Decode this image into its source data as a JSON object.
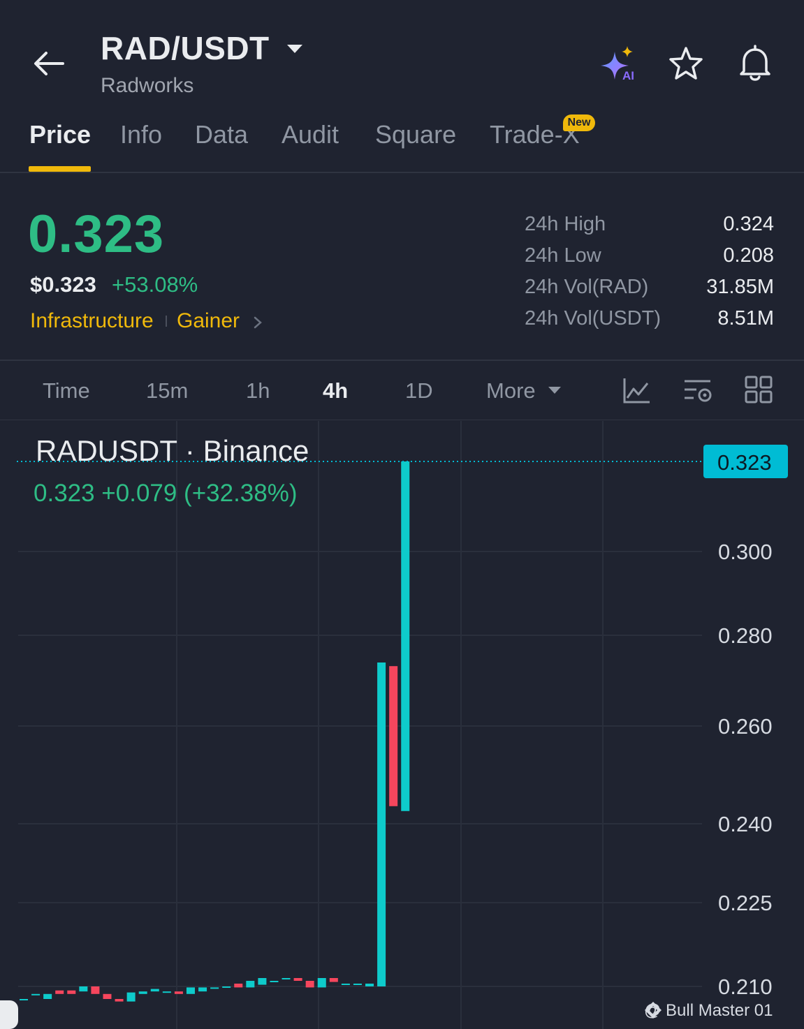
{
  "header": {
    "pair": "RAD/USDT",
    "subtitle": "Radworks",
    "icons": [
      "back-arrow-icon",
      "caret-down-icon",
      "ai-sparkle-icon",
      "star-icon",
      "bell-icon"
    ]
  },
  "tabs": {
    "items": [
      "Price",
      "Info",
      "Data",
      "Audit",
      "Square",
      "Trade-X"
    ],
    "active": "Price",
    "new_badge": "New"
  },
  "price": {
    "last": "0.323",
    "usd": "$0.323",
    "change_pct": "+53.08%",
    "tags": [
      "Infrastructure",
      "Gainer"
    ]
  },
  "stats": [
    {
      "label": "24h High",
      "value": "0.324"
    },
    {
      "label": "24h Low",
      "value": "0.208"
    },
    {
      "label": "24h Vol(RAD)",
      "value": "31.85M"
    },
    {
      "label": "24h Vol(USDT)",
      "value": "8.51M"
    }
  ],
  "intervals": {
    "items": [
      "Time",
      "15m",
      "1h",
      "4h",
      "1D",
      "More"
    ],
    "active": "4h"
  },
  "colors": {
    "background": "#1f2330",
    "up": "#2ebd85",
    "candle_up": "#0ecbcb",
    "candle_down": "#f6465d",
    "accent": "#f0b90b",
    "price_tag": "#00bcd4"
  },
  "chart_data": {
    "type": "candlestick",
    "title": "RADUSDT · Binance",
    "last_label": "0.323  +0.079 (+32.38%)",
    "last_price": 0.323,
    "y_ticks": [
      "0.300",
      "0.280",
      "0.260",
      "0.240",
      "0.225",
      "0.210"
    ],
    "y_tick_values": [
      0.3,
      0.28,
      0.26,
      0.24,
      0.225,
      0.21
    ],
    "ylim": [
      0.2075,
      0.334
    ],
    "price_tag": "0.323",
    "candles": [
      {
        "o": 0.2075,
        "c": 0.2075,
        "h": 0.2075,
        "l": 0.2075
      },
      {
        "o": 0.2085,
        "c": 0.2085,
        "h": 0.2085,
        "l": 0.2085
      },
      {
        "o": 0.2075,
        "c": 0.2085,
        "h": 0.2085,
        "l": 0.2075
      },
      {
        "o": 0.2092,
        "c": 0.2085,
        "h": 0.2092,
        "l": 0.2085
      },
      {
        "o": 0.2092,
        "c": 0.2085,
        "h": 0.2092,
        "l": 0.2085
      },
      {
        "o": 0.209,
        "c": 0.21,
        "h": 0.21,
        "l": 0.209
      },
      {
        "o": 0.21,
        "c": 0.2085,
        "h": 0.21,
        "l": 0.2085
      },
      {
        "o": 0.2085,
        "c": 0.2075,
        "h": 0.2085,
        "l": 0.2075
      },
      {
        "o": 0.2075,
        "c": 0.207,
        "h": 0.2075,
        "l": 0.207
      },
      {
        "o": 0.207,
        "c": 0.2088,
        "h": 0.2088,
        "l": 0.207
      },
      {
        "o": 0.2085,
        "c": 0.209,
        "h": 0.209,
        "l": 0.2085
      },
      {
        "o": 0.209,
        "c": 0.2095,
        "h": 0.2095,
        "l": 0.209
      },
      {
        "o": 0.209,
        "c": 0.209,
        "h": 0.209,
        "l": 0.209
      },
      {
        "o": 0.209,
        "c": 0.2085,
        "h": 0.209,
        "l": 0.2085
      },
      {
        "o": 0.2085,
        "c": 0.2098,
        "h": 0.2098,
        "l": 0.2085
      },
      {
        "o": 0.209,
        "c": 0.2098,
        "h": 0.2098,
        "l": 0.209
      },
      {
        "o": 0.2098,
        "c": 0.2098,
        "h": 0.2098,
        "l": 0.2098
      },
      {
        "o": 0.21,
        "c": 0.21,
        "h": 0.21,
        "l": 0.21
      },
      {
        "o": 0.2105,
        "c": 0.2098,
        "h": 0.2105,
        "l": 0.2098
      },
      {
        "o": 0.2098,
        "c": 0.211,
        "h": 0.211,
        "l": 0.2098
      },
      {
        "o": 0.2103,
        "c": 0.2115,
        "h": 0.2115,
        "l": 0.2103
      },
      {
        "o": 0.211,
        "c": 0.211,
        "h": 0.211,
        "l": 0.211
      },
      {
        "o": 0.2115,
        "c": 0.2115,
        "h": 0.2115,
        "l": 0.2115
      },
      {
        "o": 0.2115,
        "c": 0.211,
        "h": 0.2115,
        "l": 0.211
      },
      {
        "o": 0.211,
        "c": 0.2098,
        "h": 0.211,
        "l": 0.2098
      },
      {
        "o": 0.2098,
        "c": 0.2115,
        "h": 0.2115,
        "l": 0.2098
      },
      {
        "o": 0.2115,
        "c": 0.2108,
        "h": 0.2115,
        "l": 0.2108
      },
      {
        "o": 0.2105,
        "c": 0.2105,
        "h": 0.2105,
        "l": 0.2105
      },
      {
        "o": 0.2105,
        "c": 0.2105,
        "h": 0.2105,
        "l": 0.2105
      },
      {
        "o": 0.21,
        "c": 0.2105,
        "h": 0.2105,
        "l": 0.21
      },
      {
        "o": 0.21,
        "c": 0.274,
        "h": 0.274,
        "l": 0.21
      },
      {
        "o": 0.2732,
        "c": 0.2436,
        "h": 0.2732,
        "l": 0.2436
      },
      {
        "o": 0.2426,
        "c": 0.323,
        "h": 0.323,
        "l": 0.2426
      }
    ]
  },
  "watermark": "@ Bull Master 01"
}
